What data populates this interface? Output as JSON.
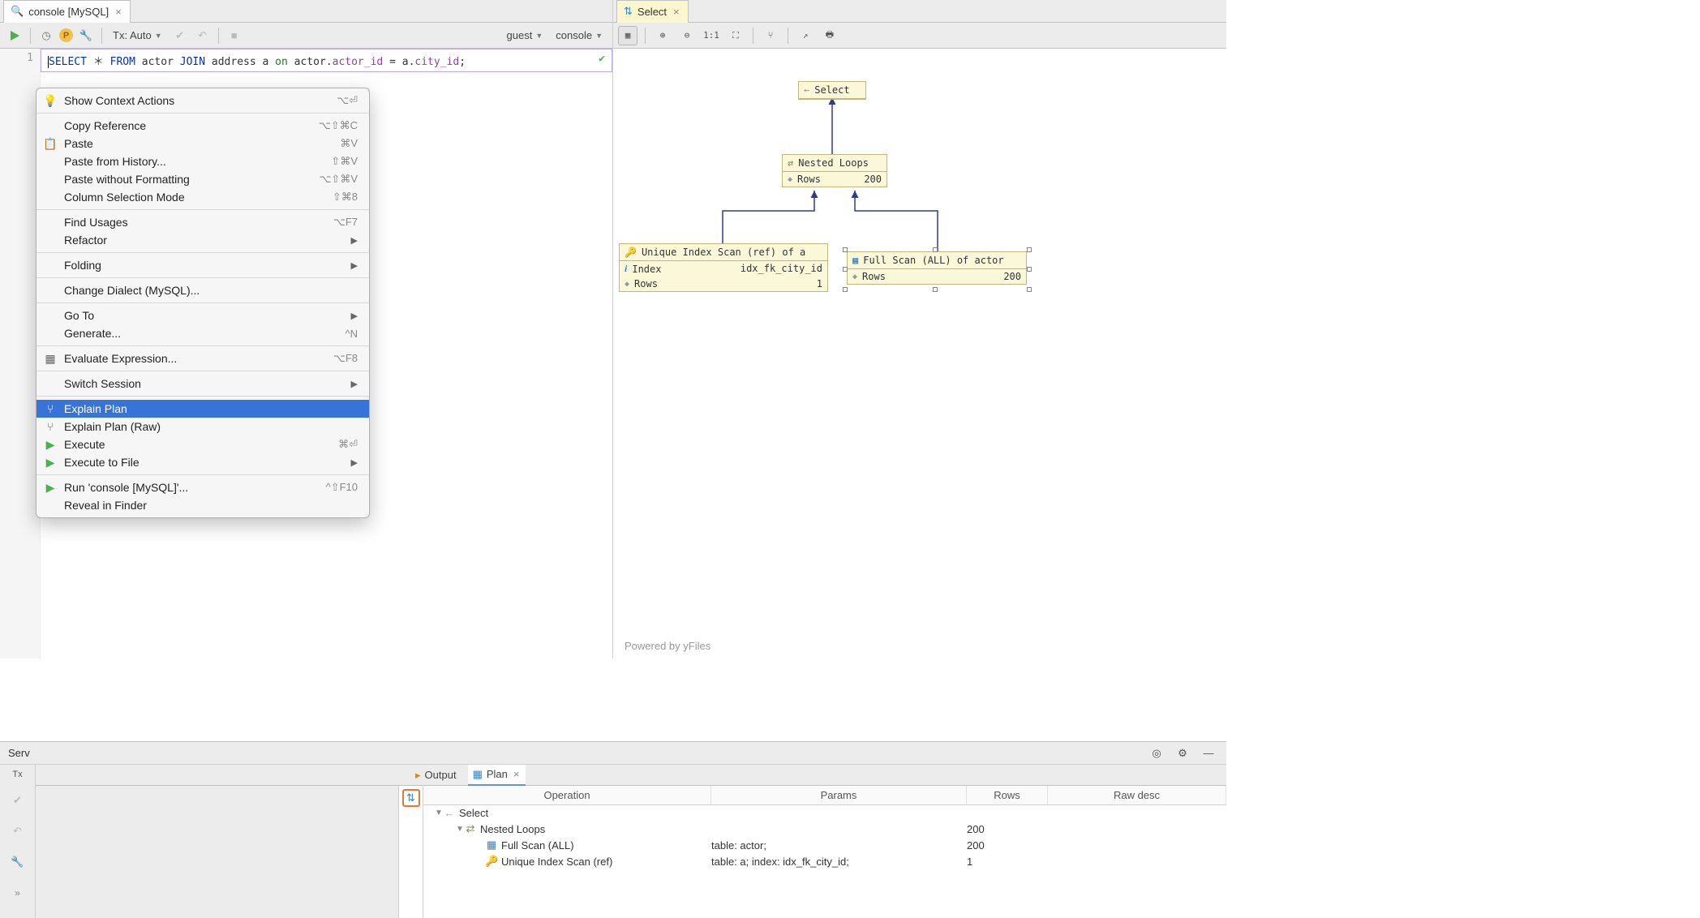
{
  "left_tab": {
    "label": "console [MySQL]"
  },
  "right_tab": {
    "label": "Select"
  },
  "toolbar": {
    "tx_label": "Tx: Auto",
    "schema_label": "guest",
    "session_label": "console"
  },
  "editor": {
    "line_no": "1",
    "sql": {
      "select": "SELECT",
      "star": "＊",
      "from": "FROM",
      "t1": "actor",
      "join": "JOIN",
      "t2": "address a",
      "on": "on",
      "lhs1": "actor",
      "lhs2": "actor_id",
      "eq": "=",
      "rhs1": "a",
      "rhs2": "city_id",
      "semi": ";"
    }
  },
  "context_menu": {
    "items": [
      {
        "icon": "💡",
        "label": "Show Context Actions",
        "shortcut": "⌥⏎"
      },
      {
        "sep": true
      },
      {
        "label": "Copy Reference",
        "shortcut": "⌥⇧⌘C"
      },
      {
        "icon": "📋",
        "label": "Paste",
        "shortcut": "⌘V"
      },
      {
        "label": "Paste from History...",
        "shortcut": "⇧⌘V"
      },
      {
        "label": "Paste without Formatting",
        "shortcut": "⌥⇧⌘V"
      },
      {
        "label": "Column Selection Mode",
        "shortcut": "⇧⌘8"
      },
      {
        "sep": true
      },
      {
        "label": "Find Usages",
        "shortcut": "⌥F7"
      },
      {
        "label": "Refactor",
        "arrow": true
      },
      {
        "sep": true
      },
      {
        "label": "Folding",
        "arrow": true
      },
      {
        "sep": true
      },
      {
        "label": "Change Dialect (MySQL)..."
      },
      {
        "sep": true
      },
      {
        "label": "Go To",
        "arrow": true
      },
      {
        "label": "Generate...",
        "shortcut": "^N"
      },
      {
        "sep": true
      },
      {
        "icon": "▦",
        "label": "Evaluate Expression...",
        "shortcut": "⌥F8"
      },
      {
        "sep": true
      },
      {
        "label": "Switch Session",
        "arrow": true
      },
      {
        "sep": true
      },
      {
        "icon": "⑂",
        "label": "Explain Plan",
        "selected": true
      },
      {
        "icon": "⑂",
        "label": "Explain Plan (Raw)"
      },
      {
        "icon": "▶",
        "label": "Execute",
        "shortcut": "⌘⏎"
      },
      {
        "icon": "▶",
        "label": "Execute to File",
        "arrow": true
      },
      {
        "sep": true
      },
      {
        "icon": "▶",
        "label": "Run 'console [MySQL]'...",
        "shortcut": "^⇧F10"
      },
      {
        "label": "Reveal in Finder"
      }
    ]
  },
  "diagram": {
    "powered": "Powered by yFiles",
    "select_node": {
      "label": "Select"
    },
    "nested_node": {
      "label": "Nested Loops",
      "rows_label": "Rows",
      "rows_val": "200"
    },
    "index_node": {
      "title": "Unique Index Scan (ref) of a",
      "idx_label": "Index",
      "idx_val": "idx_fk_city_id",
      "rows_label": "Rows",
      "rows_val": "1"
    },
    "full_node": {
      "title": "Full Scan (ALL) of actor",
      "rows_label": "Rows",
      "rows_val": "200"
    }
  },
  "bottom": {
    "title_left": "Serv",
    "tab_tx": "Tx",
    "tabs": {
      "output": "Output",
      "plan": "Plan"
    },
    "headers": {
      "op": "Operation",
      "params": "Params",
      "rows": "Rows",
      "raw": "Raw desc"
    },
    "tree": [
      {
        "indent": 0,
        "tri": true,
        "icon": "arrow-left",
        "label": "Select",
        "params": "",
        "rows": ""
      },
      {
        "indent": 1,
        "tri": true,
        "icon": "nested",
        "label": "Nested Loops",
        "params": "",
        "rows": "200"
      },
      {
        "indent": 2,
        "tri": false,
        "icon": "table",
        "label": "Full Scan (ALL)",
        "params": "table: actor;",
        "rows": "200"
      },
      {
        "indent": 2,
        "tri": false,
        "icon": "key",
        "label": "Unique Index Scan (ref)",
        "params": "table: a; index: idx_fk_city_id;",
        "rows": "1"
      }
    ]
  }
}
